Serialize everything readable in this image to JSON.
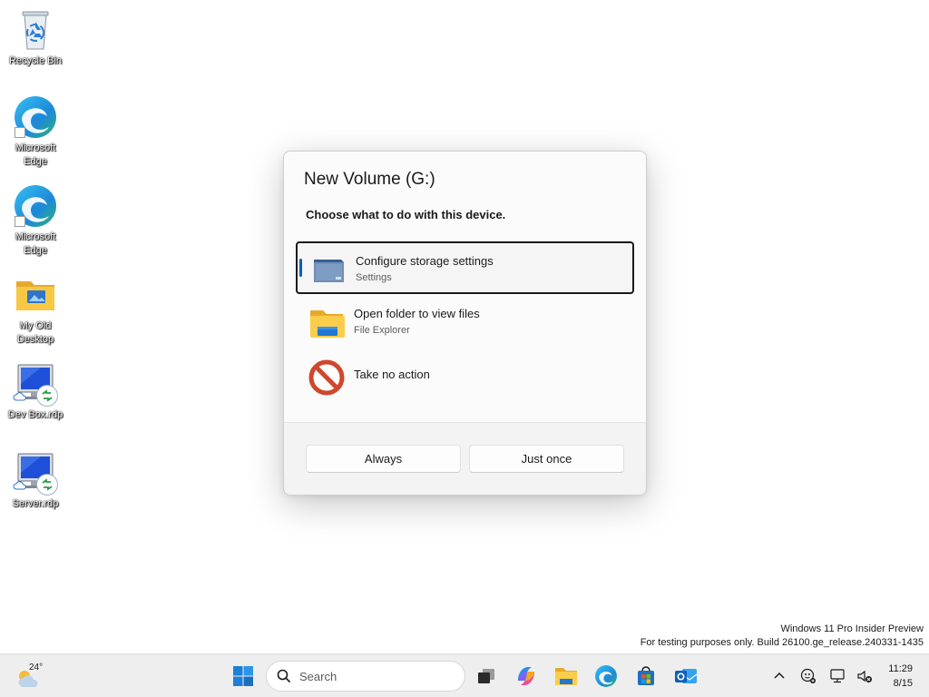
{
  "desktop": {
    "icons": [
      {
        "label": "Recycle Bin",
        "icon": "recycle-bin-icon"
      },
      {
        "label": "Microsoft Edge",
        "icon": "edge-icon"
      },
      {
        "label": "Microsoft Edge",
        "icon": "edge-icon"
      },
      {
        "label": "My Old Desktop",
        "icon": "folder-icon"
      },
      {
        "label": "Dev Box.rdp",
        "icon": "remote-desktop-icon"
      },
      {
        "label": "Server.rdp",
        "icon": "remote-desktop-icon"
      }
    ]
  },
  "dialog": {
    "title": "New Volume (G:)",
    "subtitle": "Choose what to do with this device.",
    "options": [
      {
        "title": "Configure storage settings",
        "subtitle": "Settings",
        "icon": "storage-drive-icon",
        "selected": true
      },
      {
        "title": "Open folder to view files",
        "subtitle": "File Explorer",
        "icon": "file-explorer-folder-icon",
        "selected": false
      },
      {
        "title": "Take no action",
        "subtitle": "",
        "icon": "no-action-icon",
        "selected": false
      }
    ],
    "buttons": {
      "always": "Always",
      "just_once": "Just once"
    }
  },
  "watermark": {
    "line1": "Windows 11 Pro Insider Preview",
    "line2": "For testing purposes only. Build 26100.ge_release.240331-1435"
  },
  "taskbar": {
    "weather_temp": "24°",
    "search_placeholder": "Search",
    "apps": [
      "start-icon",
      "task-view-icon",
      "copilot-icon",
      "file-explorer-icon",
      "edge-icon",
      "store-icon",
      "outlook-icon"
    ],
    "tray": [
      "chevron-up-icon",
      "accessibility-icon",
      "network-icon",
      "volume-muted-icon"
    ],
    "clock": {
      "time": "11:29",
      "date": "8/15"
    }
  },
  "colors": {
    "accent": "#005fb8",
    "taskbar": "#eeeeee",
    "dialog_footer": "#f3f3f3"
  }
}
